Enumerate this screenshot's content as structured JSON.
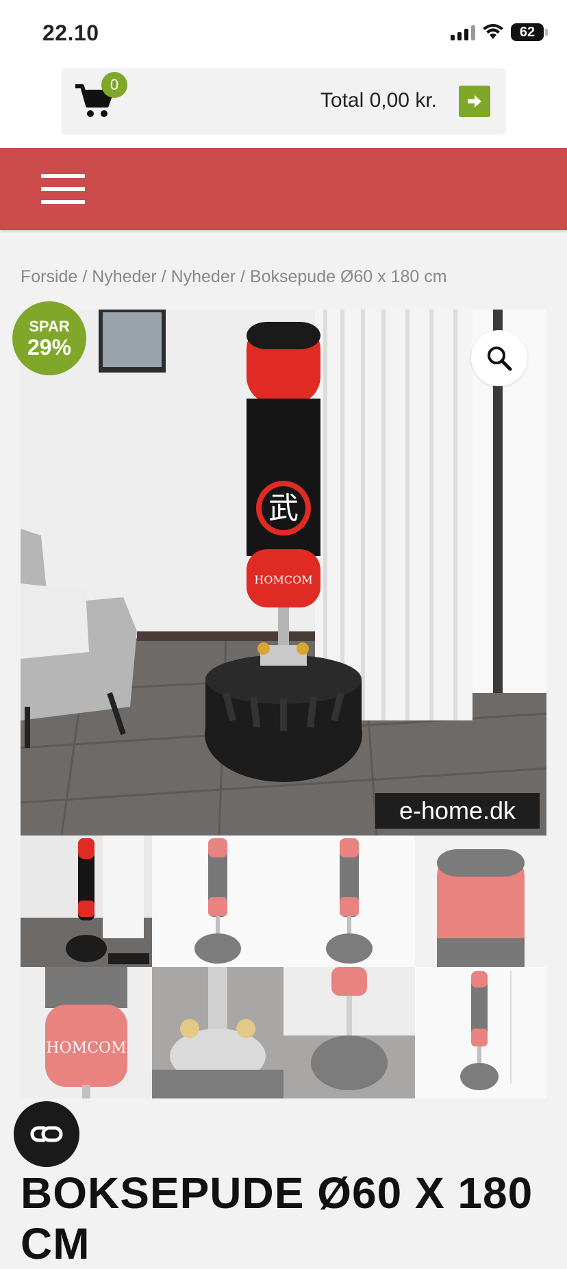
{
  "status_bar": {
    "time": "22.10",
    "battery": "62"
  },
  "cart": {
    "count": "0",
    "total": "Total 0,00 kr."
  },
  "breadcrumb": {
    "items": [
      "Forside",
      "Nyheder",
      "Nyheder",
      "Boksepude Ø60 x 180 cm"
    ],
    "separator": " / "
  },
  "sale_badge": {
    "label": "SPAR",
    "percent": "29%"
  },
  "watermark": "e-home.dk",
  "product": {
    "title": "BOKSEPUDE Ø60 X 180 CM"
  },
  "icons": {
    "cart": "cart-icon",
    "arrow": "arrow-right-icon",
    "menu": "hamburger-menu-icon",
    "zoom": "magnifier-icon",
    "cookie": "cookie-settings-icon"
  },
  "colors": {
    "accent_green": "#7fa82a",
    "nav_red": "#cc4c4c",
    "bag_red": "#e02a24"
  }
}
